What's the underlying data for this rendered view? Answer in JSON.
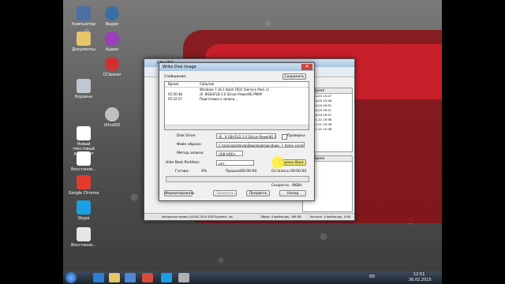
{
  "desktop": {
    "icons": [
      {
        "label": "Компьютер",
        "color": "#4a6fa5"
      },
      {
        "label": "Документы",
        "color": "#e8c46a"
      },
      {
        "label": "Корзина",
        "color": "#bfc7d1"
      },
      {
        "label": "Новый текстовый документ",
        "color": "#ffffff"
      },
      {
        "label": "Восстанов...",
        "color": "#ffffff"
      },
      {
        "label": "Google Chrome",
        "color": "#e23b2e"
      },
      {
        "label": "Skype",
        "color": "#1aa0e0"
      },
      {
        "label": "Восстанов...",
        "color": "#e6e6e6"
      }
    ],
    "icons_col2": [
      {
        "label": "Видео",
        "color": "#3a6ea5"
      },
      {
        "label": "Аудио",
        "color": "#9c3fbf"
      },
      {
        "label": "CCleaner",
        "color": "#d03030"
      },
      {
        "label": "UltraISO",
        "color": "#c0c0c0"
      }
    ]
  },
  "bg_window": {
    "title": "UltraISO",
    "columns": [
      "Дата/Время"
    ],
    "dates": [
      "2014-04-03 15:47",
      "2014-04-03 15:48",
      "2014-04-04 09:51",
      "2014-04-04 09:51",
      "2014-04-04 09:51",
      "2014-01-12 19:36",
      "2014-01-21 19:36",
      "2014-01-12 15:38"
    ],
    "status_left": "Авторские права (c)2002-2014 EZB Systems, Inc.",
    "status_mid": "Образ: 4 файла(ов), 186 KB",
    "status_right": "Каталог: 0 файла(ов), 0 KB"
  },
  "dialog": {
    "title": "Write Disk Image",
    "messages_label": "Сообщение:",
    "save_button": "Сохранить",
    "log_header_time": "Время",
    "log_header_event": "Событие",
    "log": [
      {
        "time": "",
        "event": "Windows 7 v6.1 Build 7601 (Service Pack 1)"
      },
      {
        "time": "05:50:48",
        "event": "(E: 8GB)(FLD 2.0 Silicon-Power8G PMAP"
      },
      {
        "time": "05:52:57",
        "event": "Подготовка к записи..."
      }
    ],
    "disk_drive_label": "Disk Drive:",
    "disk_drive_value": "(E:, 8 GB)(FLD 2.0 Silicon-Power8G PMAP",
    "verify_label": "Проверка",
    "image_file_label": "Файл образа:",
    "image_file_value": "C:\\Users\\andreyw\\Downloads\\windows_7_home_premium_sp1_x86_x64_ahpsnew_edition_",
    "write_method_label": "Метод записи:",
    "write_method_value": "USB-HDD+",
    "hide_partition_label": "Hide Boot Partition:",
    "hide_partition_value": "нет",
    "xpress_boot": "Xpress Boot",
    "done_label": "Готово:",
    "done_value": "0%",
    "elapsed_label": "Прошло:",
    "elapsed_value": "00:00:00",
    "remaining_label": "Осталось:",
    "remaining_value": "00:00:00",
    "speed_label": "Скорость:",
    "speed_value": "0KB/s",
    "progress": 0,
    "format_button": "Форматировать",
    "write_button": "Записать",
    "abort_button": "Прервать",
    "back_button": "Назад"
  },
  "taskbar": {
    "lang": "EN",
    "time": "12:51",
    "date": "26.02.2015"
  }
}
